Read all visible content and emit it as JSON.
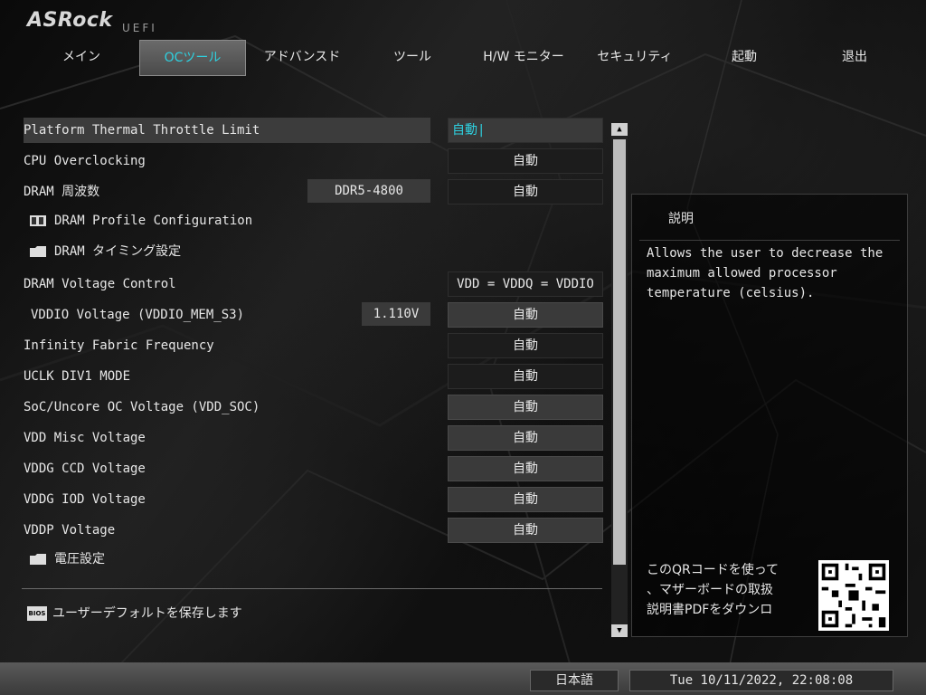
{
  "header": {
    "logo": "ASRock",
    "logo_sub": "UEFI"
  },
  "nav": {
    "tabs": [
      {
        "label": "メイン"
      },
      {
        "label": "OCツール"
      },
      {
        "label": "アドバンスド"
      },
      {
        "label": "ツール"
      },
      {
        "label": "H/W モニター"
      },
      {
        "label": "セキュリティ"
      },
      {
        "label": "起動"
      },
      {
        "label": "退出"
      }
    ],
    "active_index": 1
  },
  "settings": {
    "platform_thermal": {
      "label": "Platform Thermal Throttle Limit",
      "value": "自動|"
    },
    "cpu_oc": {
      "label": "CPU Overclocking",
      "value": "自動"
    },
    "dram_freq": {
      "label": "DRAM 周波数",
      "info": "DDR5-4800",
      "value": "自動"
    },
    "dram_profile": {
      "label": "DRAM Profile Configuration"
    },
    "dram_timing": {
      "label": "DRAM タイミング設定"
    },
    "dram_voltage_ctrl": {
      "label": "DRAM Voltage Control",
      "value": "VDD = VDDQ = VDDIO"
    },
    "vddio": {
      "label": "VDDIO Voltage (VDDIO_MEM_S3)",
      "info": "1.110V",
      "value": "自動"
    },
    "infinity_fabric": {
      "label": "Infinity Fabric Frequency",
      "value": "自動"
    },
    "uclk": {
      "label": "UCLK DIV1 MODE",
      "value": "自動"
    },
    "soc_voltage": {
      "label": "SoC/Uncore OC Voltage (VDD_SOC)",
      "value": "自動"
    },
    "vdd_misc": {
      "label": "VDD Misc Voltage",
      "value": "自動"
    },
    "vddg_ccd": {
      "label": "VDDG CCD Voltage",
      "value": "自動"
    },
    "vddg_iod": {
      "label": "VDDG IOD Voltage",
      "value": "自動"
    },
    "vddp": {
      "label": "VDDP Voltage",
      "value": "自動"
    },
    "voltage_config": {
      "label": "電圧設定"
    }
  },
  "save_default": {
    "label": "ユーザーデフォルトを保存します",
    "icon_text": "BIOS"
  },
  "description": {
    "title": "説明",
    "text": "Allows the user to decrease the\nmaximum allowed processor\ntemperature (celsius).",
    "qr_text": "このQRコードを使って\n、マザーボードの取扱\n説明書PDFをダウンロ"
  },
  "footer": {
    "language": "日本語",
    "datetime": "Tue 10/11/2022, 22:08:08"
  },
  "colors": {
    "accent": "#2ed1e0",
    "selected_row": "#3c3c3c"
  }
}
